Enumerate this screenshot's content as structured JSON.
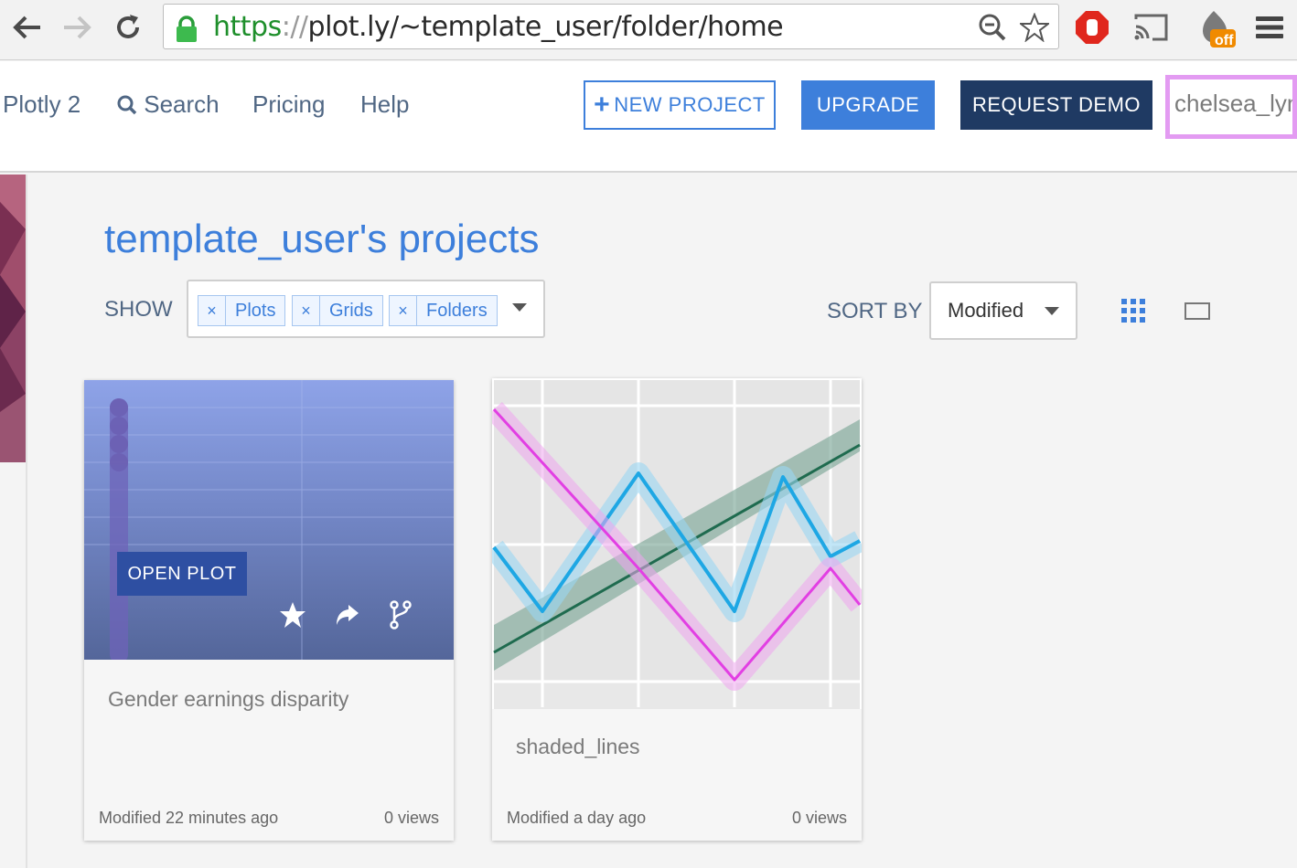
{
  "browser": {
    "url_scheme": "https",
    "url_sep": "://",
    "url_domain": "plot.ly",
    "url_path": "/~template_user/folder/home",
    "extension_badge": "off"
  },
  "header": {
    "brand": "Plotly 2",
    "search_label": "Search",
    "pricing_label": "Pricing",
    "help_label": "Help",
    "new_project_plus": "+",
    "new_project_label": "NEW PROJECT",
    "upgrade_label": "UPGRADE",
    "request_demo_label": "REQUEST DEMO",
    "username": "chelsea_lyn"
  },
  "main": {
    "title": "template_user's projects",
    "show_label": "SHOW",
    "filters": [
      {
        "remove": "×",
        "label": "Plots"
      },
      {
        "remove": "×",
        "label": "Grids"
      },
      {
        "remove": "×",
        "label": "Folders"
      }
    ],
    "sort_label": "SORT BY",
    "sort_value": "Modified"
  },
  "cards": [
    {
      "name": "Gender earnings disparity",
      "open_label": "OPEN PLOT",
      "modified": "Modified 22 minutes ago",
      "views": "0 views"
    },
    {
      "name": "shaded_lines",
      "modified": "Modified a day ago",
      "views": "0 views"
    }
  ],
  "colors": {
    "accent": "#3d7fdb",
    "navy": "#1f3a63",
    "user_highlight": "#e39bf2"
  },
  "icons": [
    "back-arrow-icon",
    "forward-arrow-icon",
    "reload-icon",
    "lock-icon",
    "zoom-icon",
    "bookmark-star-icon",
    "adblock-hand-icon",
    "cast-icon",
    "extension-off-icon",
    "menu-icon",
    "search-icon",
    "caret-down-icon",
    "grid-view-icon",
    "list-view-icon",
    "star-icon",
    "share-icon",
    "fork-icon"
  ]
}
